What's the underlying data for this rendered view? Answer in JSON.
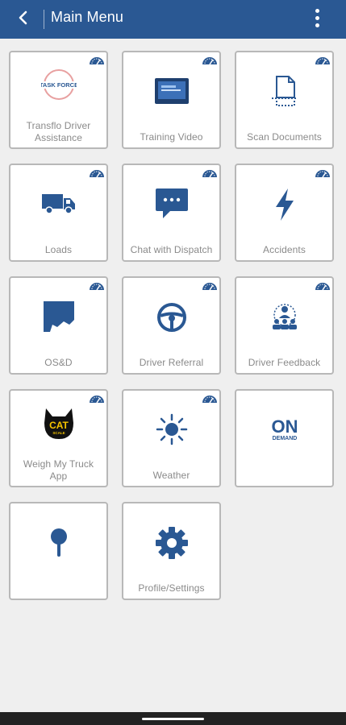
{
  "header": {
    "title": "Main Menu",
    "back_icon": "back-arrow-icon",
    "menu_icon": "kebab-menu-icon"
  },
  "colors": {
    "header_bg": "#2a5893",
    "icon_blue": "#2a5893",
    "label_gray": "#8a8a8a",
    "tile_border": "#b8b8b8",
    "page_bg": "#efefef"
  },
  "tiles": [
    {
      "label": "Transflo Driver Assistance",
      "icon": "task-force-badge-icon",
      "has_dashboard": true
    },
    {
      "label": "Training Video",
      "icon": "video-monitor-icon",
      "has_dashboard": true
    },
    {
      "label": "Scan Documents",
      "icon": "scan-document-icon",
      "has_dashboard": true
    },
    {
      "label": "Loads",
      "icon": "truck-icon",
      "has_dashboard": true
    },
    {
      "label": "Chat with Dispatch",
      "icon": "chat-bubble-icon",
      "has_dashboard": true
    },
    {
      "label": "Accidents",
      "icon": "lightning-bolt-icon",
      "has_dashboard": true
    },
    {
      "label": "OS&D",
      "icon": "damaged-box-icon",
      "has_dashboard": true
    },
    {
      "label": "Driver  Referral",
      "icon": "steering-wheel-icon",
      "has_dashboard": true
    },
    {
      "label": "Driver Feedback",
      "icon": "people-feedback-icon",
      "has_dashboard": true
    },
    {
      "label": "Weigh My Truck App",
      "icon": "cat-scale-logo-icon",
      "has_dashboard": true
    },
    {
      "label": "Weather",
      "icon": "sun-icon",
      "has_dashboard": true
    },
    {
      "label": "",
      "icon": "on-demand-logo-icon",
      "has_dashboard": false
    },
    {
      "label": "",
      "icon": "map-pin-icon",
      "has_dashboard": false
    },
    {
      "label": "Profile/Settings",
      "icon": "gear-icon",
      "has_dashboard": false
    }
  ],
  "logos": {
    "task_force_text": "TASK FORCE",
    "cat_text": "CAT",
    "cat_sub": "SCALE",
    "on_demand_big": "ON",
    "on_demand_small": "DEMAND"
  }
}
